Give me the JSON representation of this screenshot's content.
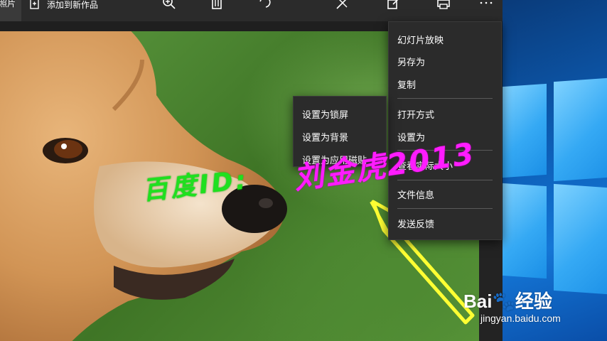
{
  "toolbar": {
    "first_label": "照片",
    "add_label": "添加到新作品"
  },
  "context_menu": {
    "items": [
      "幻灯片放映",
      "另存为",
      "复制",
      "打开方式",
      "设置为",
      "查看实际大小",
      "文件信息",
      "发送反馈"
    ]
  },
  "submenu": {
    "items": [
      "设置为锁屏",
      "设置为背景",
      "设置为应用磁贴"
    ]
  },
  "annotation": {
    "id_text": "百度ID:",
    "name_text": "刘金虎2013"
  },
  "watermark": {
    "brand": "Bai",
    "brand_cn": "经验",
    "site": "jingyan.baidu.com"
  },
  "colors": {
    "toolbar_bg": "#2b2b2b",
    "menu_bg": "#2b2b2b",
    "annotation_green": "#1fe01f",
    "annotation_magenta": "#ff1cff",
    "arrow_yellow": "#ffff33"
  }
}
